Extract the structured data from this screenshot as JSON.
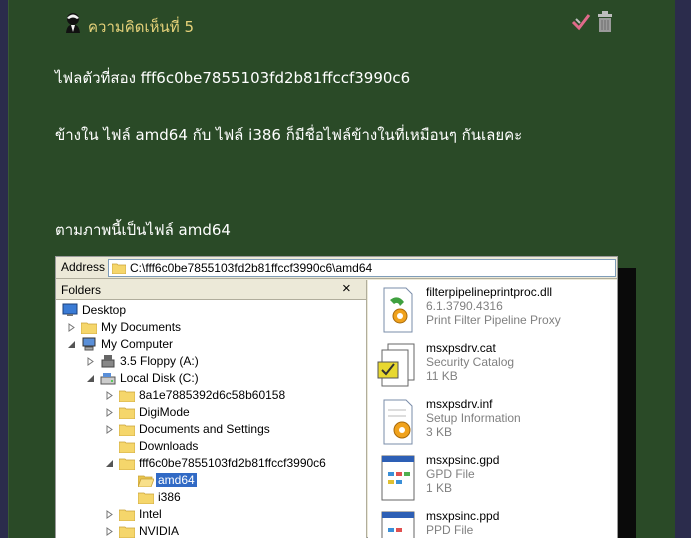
{
  "comment": {
    "title": "ความคิดเห็นที่ 5",
    "icons": [
      "commenter-avatar-icon",
      "check-icon",
      "trash-icon"
    ]
  },
  "body": {
    "line1": "ไฟลตัวที่สอง  fff6c0be7855103fd2b81ffccf3990c6",
    "line2": "ข้างใน   ไฟล์ amd64  กับ  ไฟล์  i386  ก็มีชื่อไฟล์ข้างในที่เหมือนๆ กันเลยคะ",
    "line3": "ตามภาพนี้เป็นไฟล์   amd64"
  },
  "screenshot": {
    "address_label": "Address",
    "address_value": "C:\\fff6c0be7855103fd2b81ffccf3990c6\\amd64",
    "folders_title": "Folders",
    "folders_close": "×",
    "tree": [
      {
        "label": "Desktop",
        "icon": "desktop-icon",
        "toggle": "none"
      },
      {
        "label": "My Documents",
        "icon": "folder-icon",
        "toggle": "collapsed"
      },
      {
        "label": "My Computer",
        "icon": "computer-icon",
        "toggle": "expanded"
      },
      {
        "label": "3.5 Floppy (A:)",
        "icon": "floppy-icon",
        "toggle": "collapsed"
      },
      {
        "label": "Local Disk (C:)",
        "icon": "drive-icon",
        "toggle": "expanded"
      },
      {
        "label": "8a1e7885392d6c58b60158",
        "icon": "folder-icon",
        "toggle": "collapsed"
      },
      {
        "label": "DigiMode",
        "icon": "folder-icon",
        "toggle": "collapsed"
      },
      {
        "label": "Documents and Settings",
        "icon": "folder-icon",
        "toggle": "collapsed"
      },
      {
        "label": "Downloads",
        "icon": "folder-icon",
        "toggle": "none"
      },
      {
        "label": "fff6c0be7855103fd2b81ffccf3990c6",
        "icon": "folder-icon",
        "toggle": "expanded"
      },
      {
        "label": "amd64",
        "icon": "open-folder-icon",
        "toggle": "none",
        "selected": true
      },
      {
        "label": "i386",
        "icon": "folder-icon",
        "toggle": "none"
      },
      {
        "label": "Intel",
        "icon": "folder-icon",
        "toggle": "collapsed"
      },
      {
        "label": "NVIDIA",
        "icon": "folder-icon",
        "toggle": "collapsed"
      }
    ],
    "files": [
      {
        "name": "filterpipelineprintproc.dll",
        "type": "6.1.3790.4316",
        "size": "Print Filter Pipeline Proxy",
        "icon": "dll-icon"
      },
      {
        "name": "msxpsdrv.cat",
        "type": "Security Catalog",
        "size": "11 KB",
        "icon": "catalog-icon"
      },
      {
        "name": "msxpsdrv.inf",
        "type": "Setup Information",
        "size": "3 KB",
        "icon": "inf-icon"
      },
      {
        "name": "msxpsinc.gpd",
        "type": "GPD File",
        "size": "1 KB",
        "icon": "gpd-icon"
      },
      {
        "name": "msxpsinc.ppd",
        "type": "PPD File",
        "size": "",
        "icon": "ppd-icon"
      }
    ]
  },
  "colors": {
    "page_bg": "#2b2c4c",
    "post_bg": "#2a4a27",
    "title_color": "#e6d27a",
    "selection": "#316ac5"
  }
}
